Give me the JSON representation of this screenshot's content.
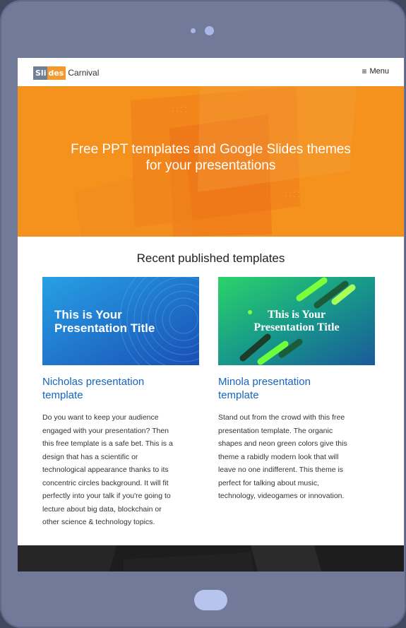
{
  "header": {
    "logo_part1": "Sli",
    "logo_part2": "des",
    "logo_part3": "Carnival",
    "menu_icon": "≡",
    "menu_label": "Menu"
  },
  "hero": {
    "title_line1": "Free PPT templates and Google Slides themes",
    "title_line2": "for your presentations"
  },
  "section": {
    "title": "Recent published templates"
  },
  "cards": [
    {
      "thumb_line1": "This is Your",
      "thumb_line2": "Presentation Title",
      "title_line1": "Nicholas presentation",
      "title_line2": "template",
      "desc_lines": [
        "Do you want to keep your audience",
        "engaged with your presentation? Then",
        "this free template is a safe bet. This is a",
        "design that has a scientific or",
        "technological appearance thanks to its",
        "concentric circles background. It will fit",
        "perfectly into your talk if you're going to",
        "lecture about big data, blockchain or",
        "other science & technology topics."
      ]
    },
    {
      "thumb_line1": "This is Your",
      "thumb_line2": "Presentation Title",
      "title_line1": "Minola presentation",
      "title_line2": "template",
      "desc_lines": [
        "Stand out from the crowd with this free",
        "presentation template. The organic",
        "shapes and neon green colors give this",
        "theme a rabidly modern look that will",
        "leave no one indifferent. This theme is",
        "perfect for talking about music,",
        "technology, videogames or innovation."
      ]
    }
  ],
  "colors": {
    "brand_orange": "#f5921e",
    "link_blue": "#1565c0",
    "tablet_frame": "#717a99"
  }
}
